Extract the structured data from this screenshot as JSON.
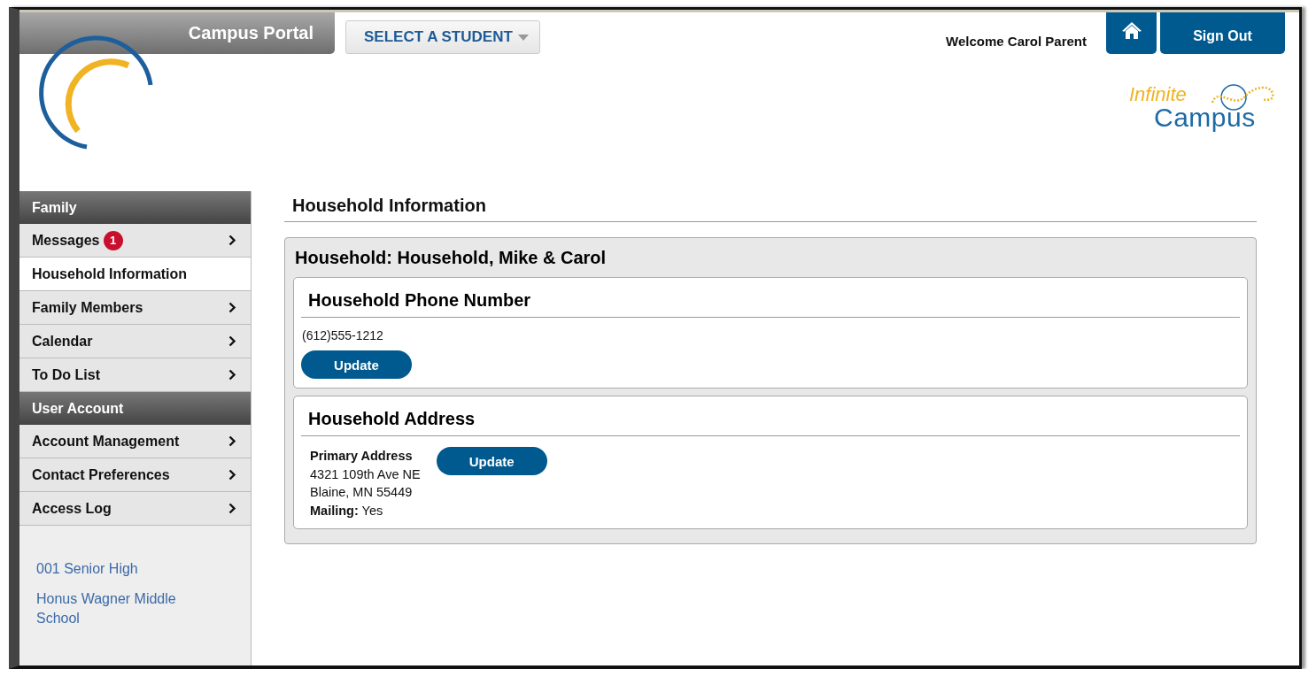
{
  "header": {
    "portal_title": "Campus Portal",
    "student_select": "SELECT A STUDENT",
    "welcome": "Welcome Carol Parent",
    "sign_out": "Sign Out",
    "brand": {
      "line_1": "Infinite",
      "line_2": "Campus"
    }
  },
  "sidebar": {
    "sections": [
      {
        "title": "Family",
        "items": [
          {
            "label": "Messages",
            "badge": "1",
            "selected": false
          },
          {
            "label": "Household Information",
            "selected": true
          },
          {
            "label": "Family Members",
            "selected": false
          },
          {
            "label": "Calendar",
            "selected": false
          },
          {
            "label": "To Do List",
            "selected": false
          }
        ]
      },
      {
        "title": "User Account",
        "items": [
          {
            "label": "Account Management",
            "selected": false
          },
          {
            "label": "Contact Preferences",
            "selected": false
          },
          {
            "label": "Access Log",
            "selected": false
          }
        ]
      }
    ],
    "schools": [
      "001 Senior High",
      "Honus Wagner Middle School"
    ]
  },
  "main": {
    "title": "Household Information",
    "household": {
      "title": "Household: Household, Mike & Carol",
      "cards": [
        {
          "kind": "phone",
          "title": "Household Phone Number",
          "value": "(612)555-1212",
          "button": "Update"
        },
        {
          "kind": "address",
          "title": "Household Address",
          "address_label": "Primary Address",
          "lines": [
            "4321 109th Ave NE",
            "Blaine, MN 55449"
          ],
          "mailing": "**Mailing:** Yes",
          "button": "Update"
        }
      ]
    }
  }
}
